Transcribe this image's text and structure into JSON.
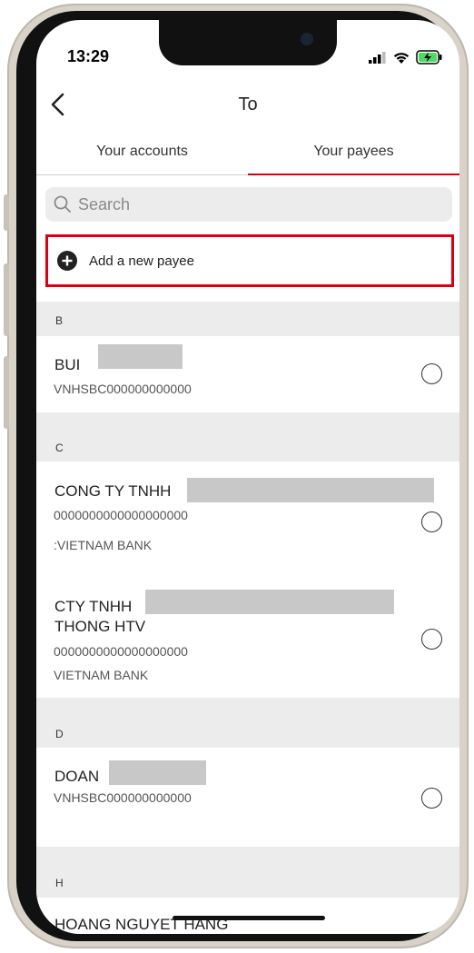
{
  "status": {
    "time": "13:29"
  },
  "nav": {
    "title": "To"
  },
  "tabs": [
    {
      "label": "Your accounts",
      "active": false
    },
    {
      "label": "Your payees",
      "active": true
    }
  ],
  "search": {
    "placeholder": "Search"
  },
  "add_payee": {
    "label": "Add a new payee"
  },
  "sections": [
    {
      "letter": "B",
      "payees": [
        {
          "name": "BUI",
          "account": "VNHSBC000000000000",
          "bank": ""
        }
      ]
    },
    {
      "letter": "C",
      "payees": [
        {
          "name": "CONG TY TNHH",
          "account": "0000000000000000000",
          "bank": ":VIETNAM BANK"
        },
        {
          "name": "CTY TNHH",
          "name_line2": "THONG HTV",
          "account": "0000000000000000000",
          "bank": "VIETNAM BANK"
        }
      ]
    },
    {
      "letter": "D",
      "payees": [
        {
          "name": "DOAN",
          "account": "VNHSBC000000000000",
          "bank": ""
        }
      ]
    },
    {
      "letter": "H",
      "payees": [
        {
          "name": "HOANG NGUYET HANG",
          "account": "",
          "bank": ""
        }
      ]
    }
  ],
  "colors": {
    "accent": "#db0011",
    "section_bg": "#ececec"
  }
}
